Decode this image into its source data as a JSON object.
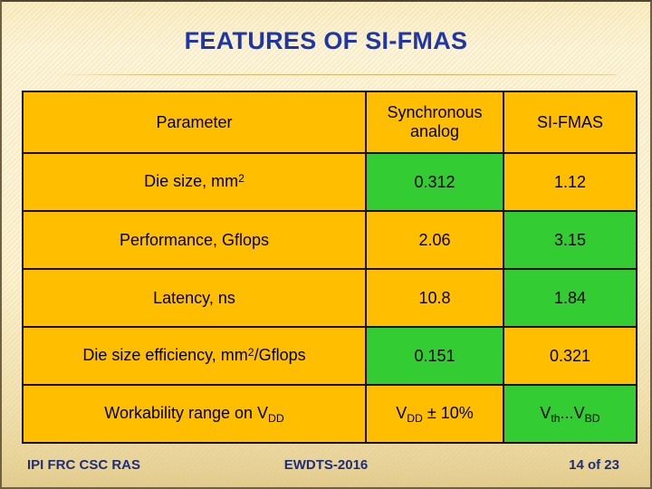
{
  "slide": {
    "title": "FEATURES OF SI-FMAS",
    "title_color": "#1f36a8",
    "background_color": "#fdf3cf"
  },
  "table": {
    "header_bg": "#ffbf00",
    "cell_bg": "#ffbf00",
    "highlight_bg": "#33cc33",
    "border_color": "#18120a",
    "columns": [
      {
        "label": "Parameter"
      },
      {
        "label_line1": "Synchronous",
        "label_line2": "analog"
      },
      {
        "label": "SI-FMAS"
      }
    ],
    "rows": [
      {
        "parameter_pre": "Die size, mm",
        "parameter_sup": "2",
        "parameter_post": "",
        "sync": "0.312",
        "sync_green": true,
        "sifmas": "1.12",
        "sifmas_green": false
      },
      {
        "parameter_pre": "Performance, Gflops",
        "parameter_sup": "",
        "parameter_post": "",
        "sync": "2.06",
        "sync_green": false,
        "sifmas": "3.15",
        "sifmas_green": true
      },
      {
        "parameter_pre": "Latency, ns",
        "parameter_sup": "",
        "parameter_post": "",
        "sync": "10.8",
        "sync_green": false,
        "sifmas": "1.84",
        "sifmas_green": true
      },
      {
        "parameter_pre": "Die size efficiency, mm",
        "parameter_sup": "2",
        "parameter_post": "/Gflops",
        "sync": "0.151",
        "sync_green": true,
        "sifmas": "0.321",
        "sifmas_green": false
      },
      {
        "parameter_pre": "Workability range on V",
        "parameter_sub": "DD",
        "parameter_post": "",
        "sync_pre": "V",
        "sync_sub": "DD",
        "sync_post": " ± 10%",
        "sync_green": false,
        "sifmas_pre": "V",
        "sifmas_sub1": "th",
        "sifmas_mid": "...V",
        "sifmas_sub2": "BD",
        "sifmas_green": true
      }
    ]
  },
  "footer": {
    "left": "IPI FRC CSC RAS",
    "center": "EWDTS-2016",
    "right": "14 of 23",
    "color": "#1f2d7a"
  }
}
